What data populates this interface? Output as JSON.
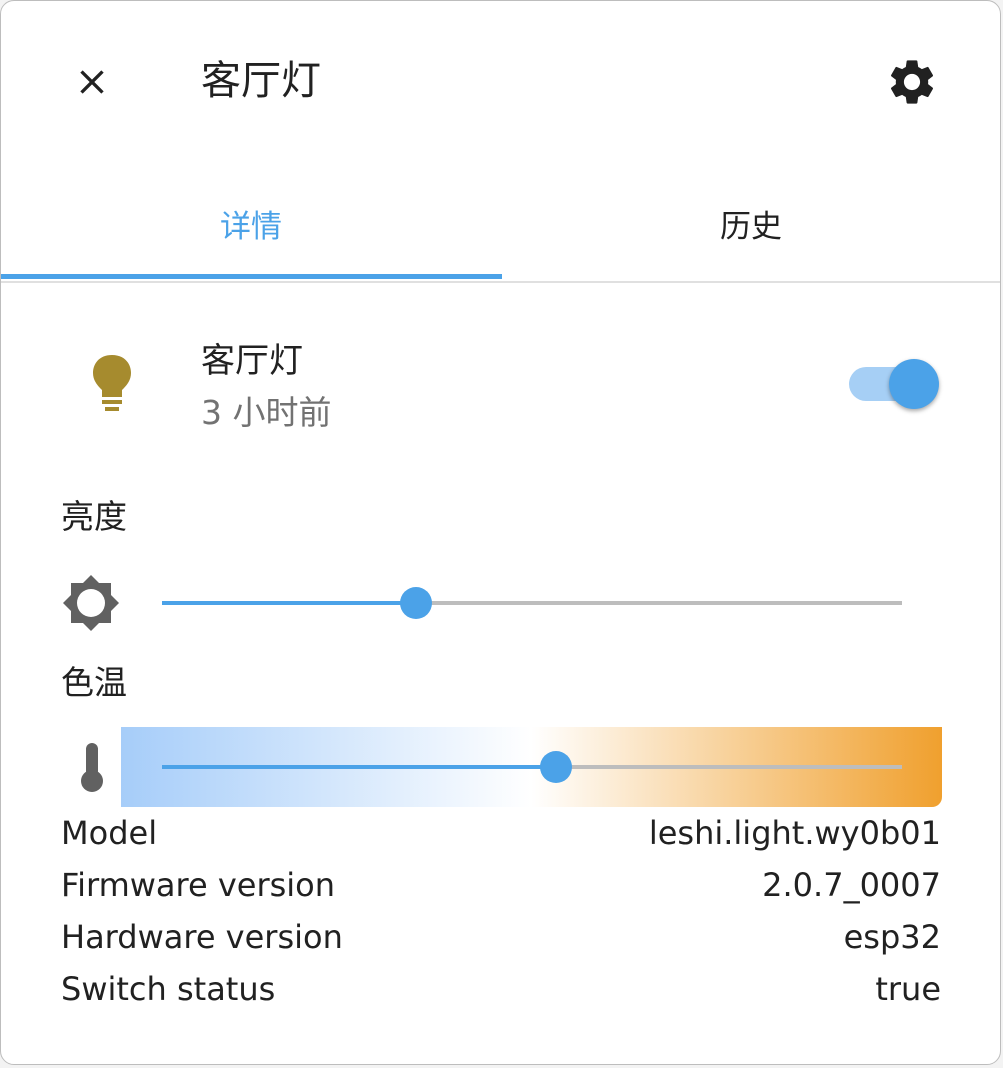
{
  "dialog": {
    "title": "客厅灯",
    "close_icon": "close-icon",
    "settings_icon": "gear-icon"
  },
  "tabs": [
    {
      "label": "详情",
      "active": true
    },
    {
      "label": "历史",
      "active": false
    }
  ],
  "entity": {
    "name": "客厅灯",
    "last_changed": "3 小时前",
    "icon": "lightbulb-icon",
    "icon_color": "#a68b2e",
    "state_on": true
  },
  "brightness": {
    "label": "亮度",
    "icon": "brightness-icon",
    "value_fraction": 0.343
  },
  "color_temp": {
    "label": "色温",
    "icon": "thermometer-icon",
    "value_fraction": 0.532,
    "gradient_colors": [
      "#a6cdf9",
      "#ffffff",
      "#f0a02e"
    ]
  },
  "attributes": [
    {
      "key": "Model",
      "value": "leshi.light.wy0b01"
    },
    {
      "key": "Firmware version",
      "value": "2.0.7_0007"
    },
    {
      "key": "Hardware version",
      "value": "esp32"
    },
    {
      "key": "Switch status",
      "value": "true"
    }
  ],
  "colors": {
    "accent": "#4ba2e8",
    "track_inactive": "#bdbdbd",
    "text_primary": "#212121",
    "text_secondary": "#727272"
  }
}
